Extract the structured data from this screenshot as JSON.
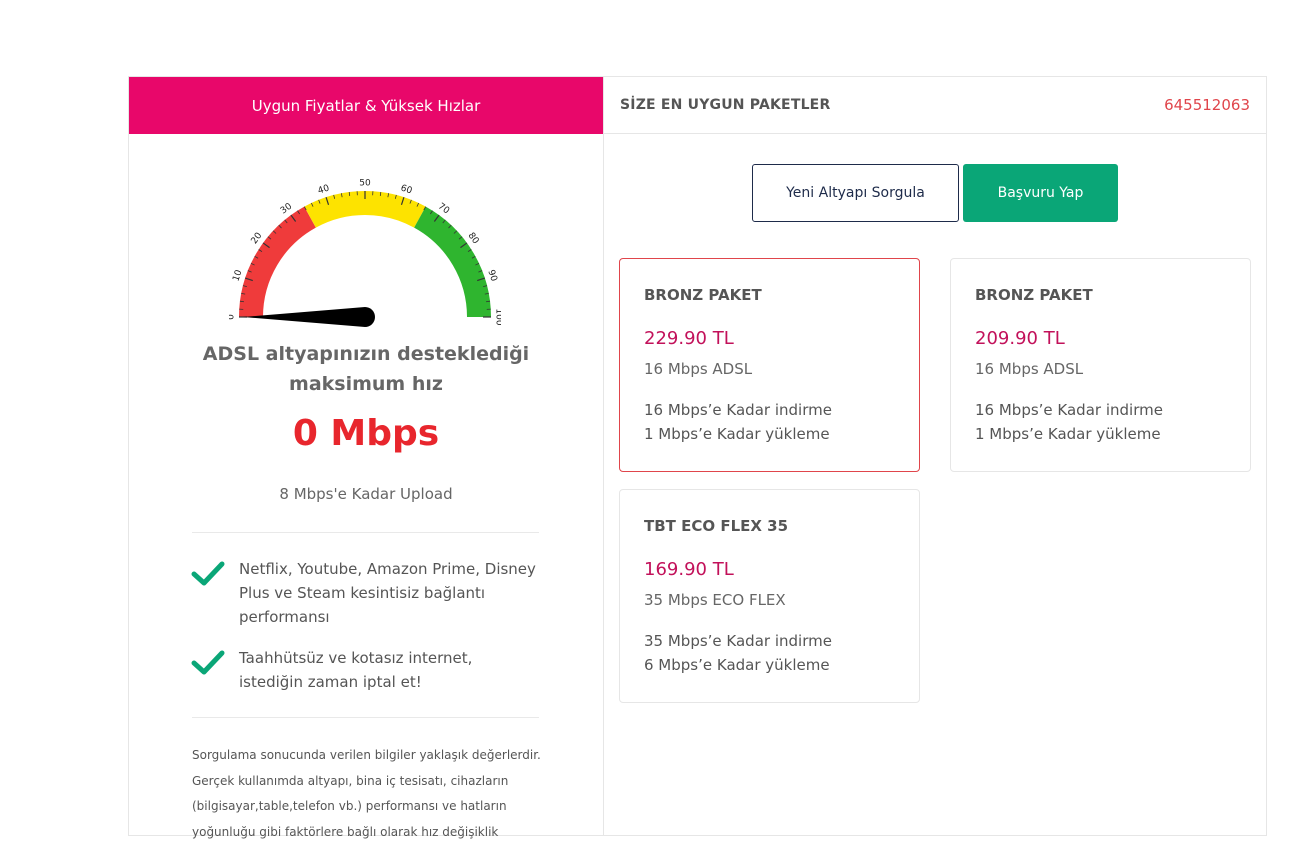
{
  "left_panel": {
    "header": "Uygun Fiyatlar & Yüksek Hızlar",
    "gauge": {
      "value": 0,
      "min": 0,
      "max": 100,
      "ticks": [
        "0",
        "10",
        "20",
        "30",
        "40",
        "50",
        "60",
        "70",
        "80",
        "90",
        "100"
      ],
      "colors": {
        "red": "#ef3b3b",
        "yellow": "#fde300",
        "green": "#2fb52f"
      }
    },
    "infra_text": "ADSL altyapınızın desteklediği maksimum hız",
    "speed": "0 Mbps",
    "upload": "8 Mbps'e Kadar Upload",
    "features": [
      {
        "text": "Netflix, Youtube, Amazon Prime, Disney Plus ve Steam kesintisiz bağlantı performansı"
      },
      {
        "text": "Taahhütsüz ve kotasız internet, istediğin zaman iptal et!"
      }
    ],
    "note": "Sorgulama sonucunda verilen bilgiler yaklaşık değerlerdir. Gerçek kullanımda altyapı, bina iç tesisatı, cihazların (bilgisayar,table,telefon vb.) performansı ve hatların yoğunluğu gibi faktörlere bağlı olarak hız değişiklik"
  },
  "right_panel": {
    "header": "SİZE EN UYGUN PAKETLER",
    "phone": "645512063",
    "buttons": {
      "query": "Yeni Altyapı Sorgula",
      "apply": "Başvuru Yap"
    },
    "packages": [
      {
        "name": "BRONZ PAKET",
        "price": "229.90 TL",
        "type": "16 Mbps ADSL",
        "download": "16 Mbps’e Kadar indirme",
        "upload": "1 Mbps’e Kadar yükleme",
        "selected": true
      },
      {
        "name": "BRONZ PAKET",
        "price": "209.90 TL",
        "type": "16 Mbps ADSL",
        "download": "16 Mbps’e Kadar indirme",
        "upload": "1 Mbps’e Kadar yükleme",
        "selected": false
      },
      {
        "name": "TBT ECO FLEX 35",
        "price": "169.90 TL",
        "type": "35 Mbps ECO FLEX",
        "download": "35 Mbps’e Kadar indirme",
        "upload": "6 Mbps’e Kadar yükleme",
        "selected": false
      }
    ]
  },
  "colors": {
    "brand": "#e8076a",
    "price": "#c2115a",
    "phone": "#e0454b",
    "speed": "#e8262d",
    "apply_button": "#0aa677",
    "check": "#0aa677"
  }
}
